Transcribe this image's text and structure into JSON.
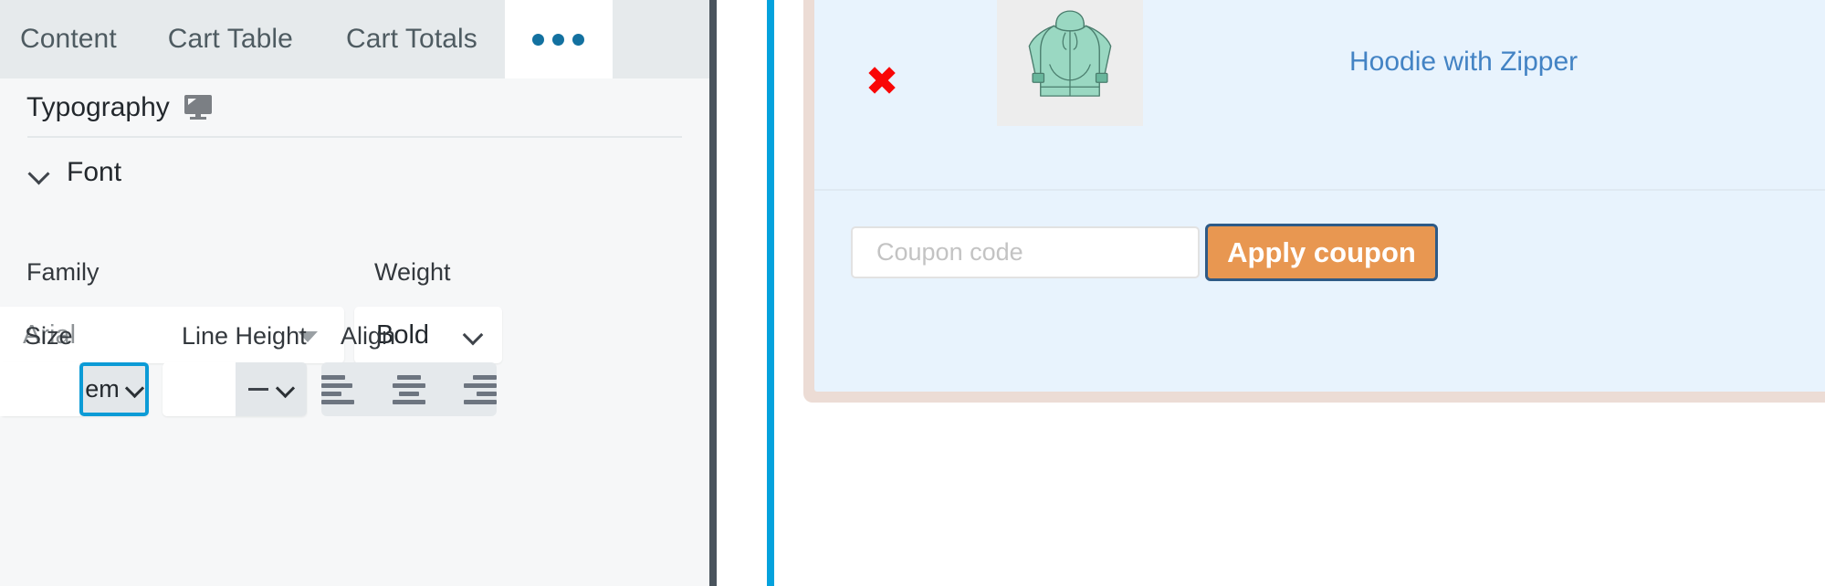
{
  "editor": {
    "tabs": [
      {
        "label": "Content",
        "active": false
      },
      {
        "label": "Cart Table",
        "active": false
      },
      {
        "label": "Cart Totals",
        "active": false
      },
      {
        "label": "...",
        "active": true,
        "icon": "ellipsis-icon"
      }
    ],
    "section": {
      "title": "Typography",
      "device_icon": "monitor-icon"
    },
    "accordion": {
      "label": "Font",
      "chevron_icon": "chevron-down-icon",
      "expanded": true
    },
    "controls": {
      "family": {
        "label": "Family",
        "value": "Arial",
        "caret_icon": "caret-down-icon"
      },
      "weight": {
        "label": "Weight",
        "value": "Bold",
        "chevron_icon": "chevron-down-icon"
      },
      "size": {
        "label": "Size",
        "value": "",
        "unit": "em",
        "unit_chevron_icon": "chevron-down-icon",
        "focused": true,
        "focus_color": "#0c9bd6"
      },
      "line_height": {
        "label": "Line Height",
        "value": "",
        "unit": "—",
        "unit_chevron_icon": "chevron-down-icon"
      },
      "align": {
        "label": "Align",
        "options": [
          {
            "name": "align-left",
            "icon": "align-left-icon"
          },
          {
            "name": "align-center",
            "icon": "align-center-icon"
          },
          {
            "name": "align-right",
            "icon": "align-right-icon"
          }
        ]
      }
    }
  },
  "preview": {
    "cart": {
      "border_color": "#ecdcd5",
      "background_color": "#e8f3fd",
      "item": {
        "remove_icon": "remove-x-icon",
        "remove_color": "#f90606",
        "thumbnail_icon": "hoodie-thumbnail",
        "name": "Hoodie with Zipper",
        "name_color": "#4383c4"
      },
      "coupon": {
        "placeholder": "Coupon code",
        "value": "",
        "button_label": "Apply coupon",
        "button_bg": "#e89751",
        "button_border": "#2e5a86"
      }
    }
  },
  "rules": {
    "dark_rule_color": "#4a545d",
    "blue_rule_color": "#04a2dd"
  }
}
